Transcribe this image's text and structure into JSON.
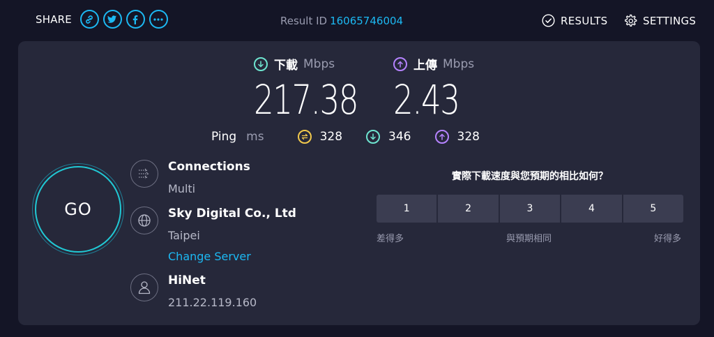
{
  "header": {
    "share_label": "SHARE",
    "share_icons": [
      "link-icon",
      "twitter-icon",
      "facebook-icon",
      "more-icon"
    ],
    "result_id_label": "Result ID",
    "result_id_value": "16065746004",
    "results_label": "RESULTS",
    "settings_label": "SETTINGS"
  },
  "metrics": {
    "download": {
      "label": "下載",
      "unit": "Mbps",
      "value": "217.38",
      "color": "#6ee5d0"
    },
    "upload": {
      "label": "上傳",
      "unit": "Mbps",
      "value": "2.43",
      "color": "#b583ff"
    }
  },
  "ping": {
    "label": "Ping",
    "unit": "ms",
    "idle": {
      "value": "328",
      "color": "#f2c94c"
    },
    "download": {
      "value": "346",
      "color": "#6ee5d0"
    },
    "upload": {
      "value": "328",
      "color": "#b583ff"
    }
  },
  "go_label": "GO",
  "connections": {
    "title": "Connections",
    "value": "Multi"
  },
  "server": {
    "title": "Sky Digital Co., Ltd",
    "location": "Taipei",
    "change_label": "Change Server"
  },
  "isp": {
    "title": "HiNet",
    "ip": "211.22.119.160"
  },
  "survey": {
    "question": "實際下載速度與您預期的相比如何？",
    "options": [
      "1",
      "2",
      "3",
      "4",
      "5"
    ],
    "low_label": "差得多",
    "mid_label": "與預期相同",
    "high_label": "好得多"
  },
  "colors": {
    "accent": "#1cb9f3",
    "background": "#141526",
    "panel": "#26283a"
  }
}
